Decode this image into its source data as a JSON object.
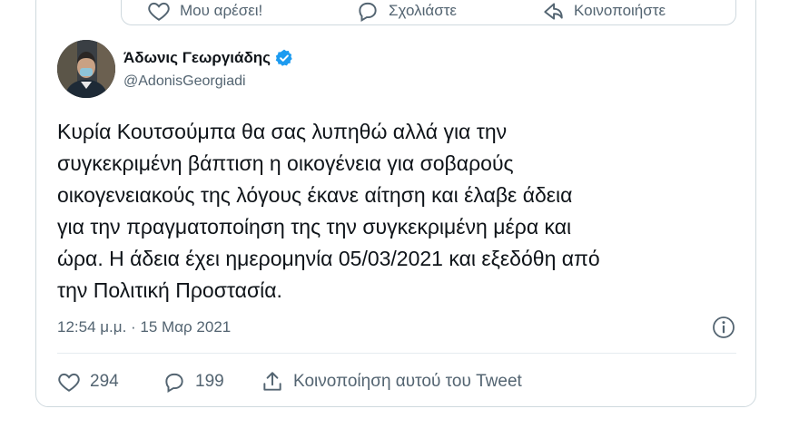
{
  "quoted_tweet_actions": {
    "like_label": "Μου αρέσει!",
    "reply_label": "Σχολιάστε",
    "share_label": "Κοινοποιήστε"
  },
  "tweet": {
    "author": {
      "display_name": "Άδωνις Γεωργιάδης",
      "handle": "@AdonisGeorgiadi",
      "verified": true
    },
    "text_lines": [
      "Κυρία Κουτσούμπα θα σας λυπηθώ αλλά για την",
      "συγκεκριμένη βάπτιση η οικογένεια για σοβαρούς",
      "οικογενειακούς της λόγους έκανε αίτηση και έλαβε άδεια",
      "για την πραγματοποίηση της την συγκεκριμένη μέρα και",
      "ώρα. Η άδεια έχει ημερομηνία 05/03/2021 και εξεδόθη από",
      "την Πολιτική Προστασία."
    ],
    "timestamp": "12:54 μ.μ. · 15 Μαρ 2021",
    "likes": "294",
    "replies": "199",
    "share_label": "Κοινοποίηση αυτού του Tweet"
  },
  "colors": {
    "text": "#0f1419",
    "secondary": "#536471",
    "border": "#cfd9de",
    "verified_badge": "#1d9bf0"
  },
  "icons": [
    "heart-icon",
    "reply-bubble-icon",
    "share-icon",
    "info-icon",
    "verified-badge-icon"
  ]
}
